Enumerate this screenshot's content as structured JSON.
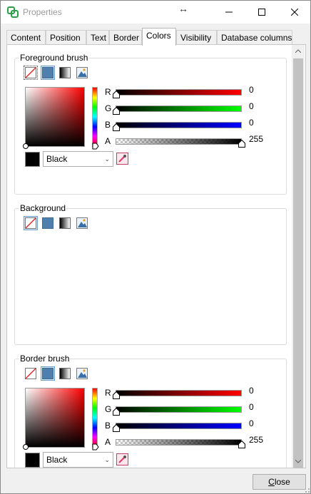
{
  "window": {
    "title": "Properties",
    "resize_indicator": "↔",
    "controls": [
      "minimize",
      "maximize",
      "close"
    ]
  },
  "tabs": [
    {
      "label": "Content",
      "active": false
    },
    {
      "label": "Position",
      "active": false
    },
    {
      "label": "Text",
      "active": false
    },
    {
      "label": "Border",
      "active": false
    },
    {
      "label": "Colors",
      "active": true
    },
    {
      "label": "Visibility",
      "active": false
    },
    {
      "label": "Database columns",
      "active": false
    }
  ],
  "foreground": {
    "title": "Foreground brush",
    "brush_types": [
      "no-brush-icon",
      "solid-color-icon",
      "gradient-icon",
      "image-brush-icon"
    ],
    "selected_brush": "solid-color-icon",
    "channels": {
      "r": {
        "label": "R",
        "value": "0"
      },
      "g": {
        "label": "G",
        "value": "0"
      },
      "b": {
        "label": "B",
        "value": "0"
      },
      "a": {
        "label": "A",
        "value": "255"
      }
    },
    "color_name": "Black"
  },
  "background": {
    "title": "Background",
    "brush_types": [
      "no-brush-icon",
      "solid-color-icon",
      "gradient-icon",
      "image-brush-icon"
    ],
    "selected_brush": "no-brush-icon"
  },
  "border": {
    "title": "Border brush",
    "brush_types": [
      "no-brush-icon",
      "solid-color-icon",
      "gradient-icon",
      "image-brush-icon"
    ],
    "selected_brush": "solid-color-icon",
    "channels": {
      "r": {
        "label": "R",
        "value": "0"
      },
      "g": {
        "label": "G",
        "value": "0"
      },
      "b": {
        "label": "B",
        "value": "0"
      },
      "a": {
        "label": "A",
        "value": "255"
      }
    },
    "color_name": "Black"
  },
  "footer": {
    "close_label_accel": "C",
    "close_label_rest": "lose"
  },
  "colors": {
    "accent": "#4f7faf",
    "red_channel": "#ff0000",
    "green_channel": "#00ff00",
    "blue_channel": "#0000ff",
    "selected_color": "#000000"
  }
}
